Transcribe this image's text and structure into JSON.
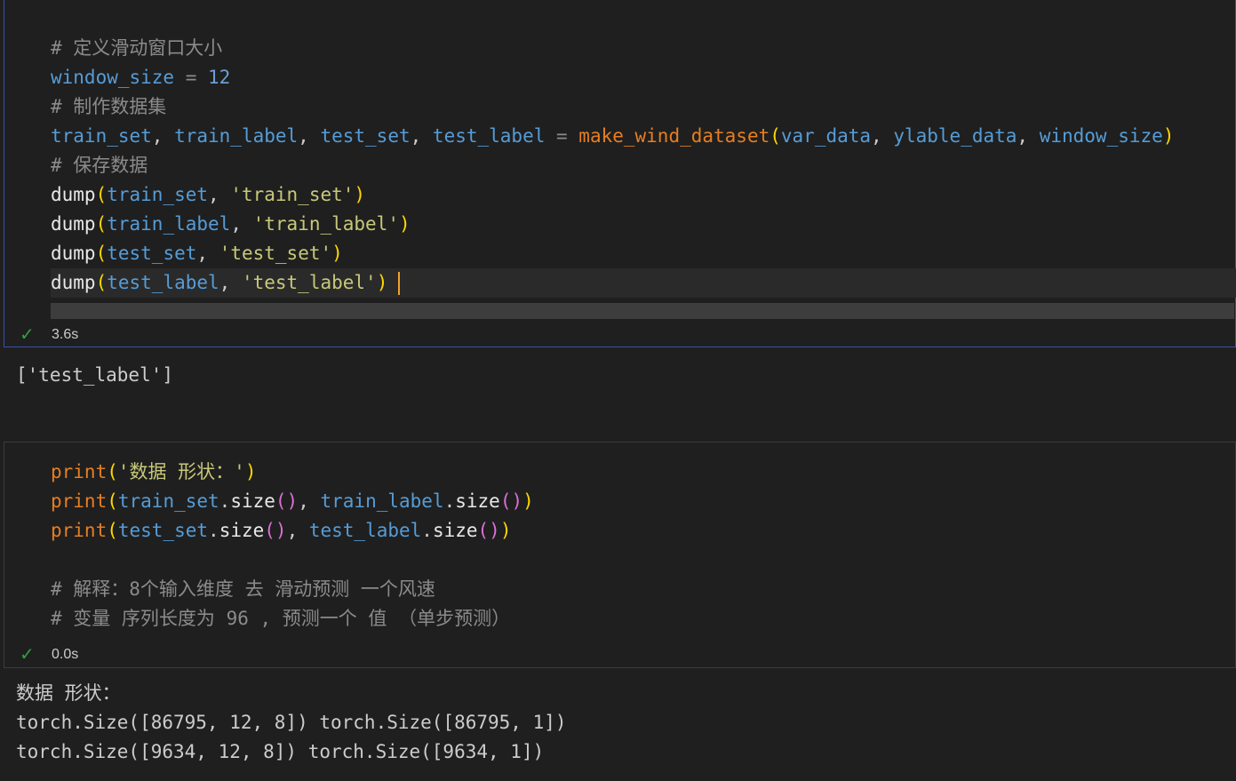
{
  "cell1": {
    "lines": [
      [
        {
          "t": "# 定义滑动窗口大小",
          "c": "cm"
        }
      ],
      [
        {
          "t": "window_size",
          "c": "var"
        },
        {
          "t": " = ",
          "c": "op"
        },
        {
          "t": "12",
          "c": "num"
        }
      ],
      [
        {
          "t": "# 制作数据集",
          "c": "cm"
        }
      ],
      [
        {
          "t": "train_set",
          "c": "var"
        },
        {
          "t": ", ",
          "c": "pl"
        },
        {
          "t": "train_label",
          "c": "var"
        },
        {
          "t": ", ",
          "c": "pl"
        },
        {
          "t": "test_set",
          "c": "var"
        },
        {
          "t": ", ",
          "c": "pl"
        },
        {
          "t": "test_label",
          "c": "var"
        },
        {
          "t": " = ",
          "c": "op"
        },
        {
          "t": "make_wind_dataset",
          "c": "fn2"
        },
        {
          "t": "(",
          "c": "p1"
        },
        {
          "t": "var_data",
          "c": "var"
        },
        {
          "t": ", ",
          "c": "pl"
        },
        {
          "t": "ylable_data",
          "c": "var"
        },
        {
          "t": ", ",
          "c": "pl"
        },
        {
          "t": "window_size",
          "c": "var"
        },
        {
          "t": ")",
          "c": "p1"
        }
      ],
      [
        {
          "t": "# 保存数据",
          "c": "cm"
        }
      ],
      [
        {
          "t": "dump",
          "c": "fn"
        },
        {
          "t": "(",
          "c": "p1"
        },
        {
          "t": "train_set",
          "c": "var"
        },
        {
          "t": ", ",
          "c": "pl"
        },
        {
          "t": "'train_set'",
          "c": "str"
        },
        {
          "t": ")",
          "c": "p1"
        }
      ],
      [
        {
          "t": "dump",
          "c": "fn"
        },
        {
          "t": "(",
          "c": "p1"
        },
        {
          "t": "train_label",
          "c": "var"
        },
        {
          "t": ", ",
          "c": "pl"
        },
        {
          "t": "'train_label'",
          "c": "str"
        },
        {
          "t": ")",
          "c": "p1"
        }
      ],
      [
        {
          "t": "dump",
          "c": "fn"
        },
        {
          "t": "(",
          "c": "p1"
        },
        {
          "t": "test_set",
          "c": "var"
        },
        {
          "t": ", ",
          "c": "pl"
        },
        {
          "t": "'test_set'",
          "c": "str"
        },
        {
          "t": ")",
          "c": "p1"
        }
      ],
      [
        {
          "t": "dump",
          "c": "fn"
        },
        {
          "t": "(",
          "c": "p1"
        },
        {
          "t": "test_label",
          "c": "var"
        },
        {
          "t": ", ",
          "c": "pl"
        },
        {
          "t": "'test_label'",
          "c": "str"
        },
        {
          "t": ")",
          "c": "p1"
        }
      ]
    ],
    "exec_time": "3.6s",
    "output": [
      "['test_label']"
    ]
  },
  "cell2": {
    "lines": [
      [
        {
          "t": "print",
          "c": "fn2"
        },
        {
          "t": "(",
          "c": "p1"
        },
        {
          "t": "'数据 形状：'",
          "c": "str"
        },
        {
          "t": ")",
          "c": "p1"
        }
      ],
      [
        {
          "t": "print",
          "c": "fn2"
        },
        {
          "t": "(",
          "c": "p1"
        },
        {
          "t": "train_set",
          "c": "var"
        },
        {
          "t": ".",
          "c": "pl"
        },
        {
          "t": "size",
          "c": "fn"
        },
        {
          "t": "()",
          "c": "p2"
        },
        {
          "t": ", ",
          "c": "pl"
        },
        {
          "t": "train_label",
          "c": "var"
        },
        {
          "t": ".",
          "c": "pl"
        },
        {
          "t": "size",
          "c": "fn"
        },
        {
          "t": "()",
          "c": "p2"
        },
        {
          "t": ")",
          "c": "p1"
        }
      ],
      [
        {
          "t": "print",
          "c": "fn2"
        },
        {
          "t": "(",
          "c": "p1"
        },
        {
          "t": "test_set",
          "c": "var"
        },
        {
          "t": ".",
          "c": "pl"
        },
        {
          "t": "size",
          "c": "fn"
        },
        {
          "t": "()",
          "c": "p2"
        },
        {
          "t": ", ",
          "c": "pl"
        },
        {
          "t": "test_label",
          "c": "var"
        },
        {
          "t": ".",
          "c": "pl"
        },
        {
          "t": "size",
          "c": "fn"
        },
        {
          "t": "()",
          "c": "p2"
        },
        {
          "t": ")",
          "c": "p1"
        }
      ],
      [],
      [
        {
          "t": "# 解释：8个输入维度 去 滑动预测 一个风速",
          "c": "cm"
        }
      ],
      [
        {
          "t": "# 变量 序列长度为 96 , 预测一个 值 （单步预测）",
          "c": "cm"
        }
      ]
    ],
    "exec_time": "0.0s",
    "output": [
      "数据 形状：",
      "torch.Size([86795, 12, 8]) torch.Size([86795, 1])",
      "torch.Size([9634, 12, 8]) torch.Size([9634, 1])"
    ]
  }
}
